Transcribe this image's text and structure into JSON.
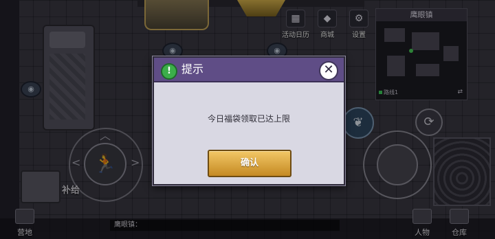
{
  "top_menu": {
    "items": [
      {
        "label": "活动日历",
        "icon": "calendar-icon"
      },
      {
        "label": "商城",
        "icon": "diamond-icon"
      },
      {
        "label": "设置",
        "icon": "gear-icon"
      }
    ]
  },
  "minimap": {
    "title": "鹰眼镇",
    "route_label": "路线1"
  },
  "joystick": {
    "icon": "running-man-icon"
  },
  "supply": {
    "label": "补给"
  },
  "chat": {
    "text": "鹰眼镇："
  },
  "bottom_buttons": [
    {
      "label": "营地",
      "icon": "camp-icon"
    },
    {
      "label": "人物",
      "icon": "person-icon"
    },
    {
      "label": "仓库",
      "icon": "warehouse-icon"
    }
  ],
  "dialog": {
    "title": "提示",
    "message": "今日福袋领取已达上限",
    "confirm_label": "确认",
    "close_glyph": "✕",
    "alert_glyph": "!"
  },
  "colors": {
    "dialog_header": "#5f4d86",
    "dialog_body": "#d9d8e3",
    "confirm_button": "#e0a93f",
    "alert_icon": "#3cae4a"
  }
}
